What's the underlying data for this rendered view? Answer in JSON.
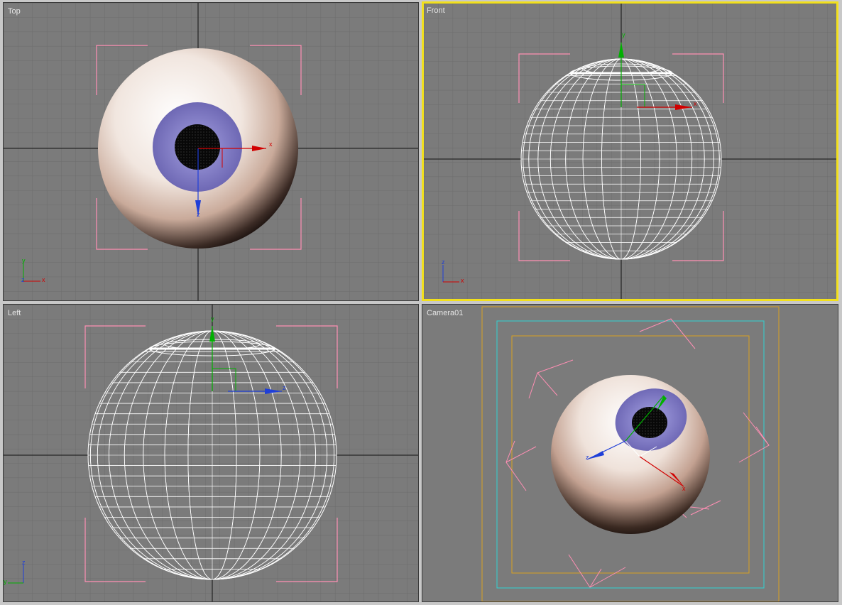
{
  "viewports": {
    "top": {
      "label": "Top"
    },
    "front": {
      "label": "Front"
    },
    "left": {
      "label": "Left"
    },
    "camera": {
      "label": "Camera01"
    }
  },
  "axis_labels": {
    "x": "x",
    "y": "y",
    "z": "z"
  },
  "colors": {
    "viewport_bg": "#7b7b7b",
    "grid": "#6c6c6c",
    "grid_major": "#111111",
    "active_border": "#f2e01c",
    "safe_frame": "#ff8fb4",
    "wireframe": "#ffffff",
    "axis_x": "#d10000",
    "axis_y": "#00b000",
    "axis_z": "#1f3fd8",
    "iris": "#8a86c8",
    "title_safe": "#2fd3d3",
    "action_safe": "#d8a020"
  }
}
